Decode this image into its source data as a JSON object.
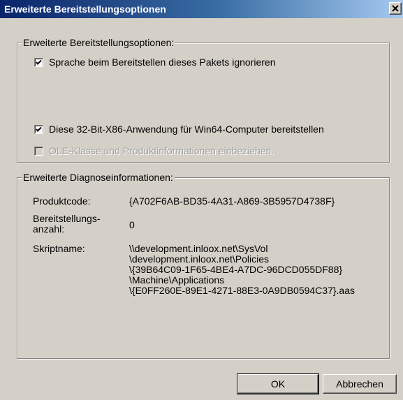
{
  "window": {
    "title": "Erweiterte Bereitstellungsoptionen",
    "close_label": "close"
  },
  "group_options": {
    "legend": "Erweiterte Bereitstellungsoptionen:",
    "checkbox_language": {
      "label": "Sprache beim Bereitstellen dieses Pakets ignorieren",
      "checked": true
    },
    "checkbox_x86": {
      "label": "Diese 32-Bit-X86-Anwendung für Win64-Computer bereitstellen",
      "checked": true
    },
    "checkbox_ole": {
      "label": "OLE-Klasse und Produktinformationen einbeziehen.",
      "checked": false,
      "disabled": true
    }
  },
  "group_diagnostics": {
    "legend": "Erweiterte Diagnoseinformationen:",
    "product_code_label": "Produktcode:",
    "product_code_value": "{A702F6AB-BD35-4A31-A869-3B5957D4738F}",
    "deploy_count_label_1": "Bereitstellungs-",
    "deploy_count_label_2": "anzahl:",
    "deploy_count_value": "0",
    "script_name_label": "Skriptname:",
    "script_lines": [
      "\\\\development.inloox.net\\SysVol",
      "\\development.inloox.net\\Policies",
      "\\{39B64C09-1F65-4BE4-A7DC-96DCD055DF88}",
      "\\Machine\\Applications",
      "\\{E0FF260E-89E1-4271-88E3-0A9DB0594C37}.aas"
    ]
  },
  "buttons": {
    "ok": "OK",
    "cancel": "Abbrechen"
  }
}
